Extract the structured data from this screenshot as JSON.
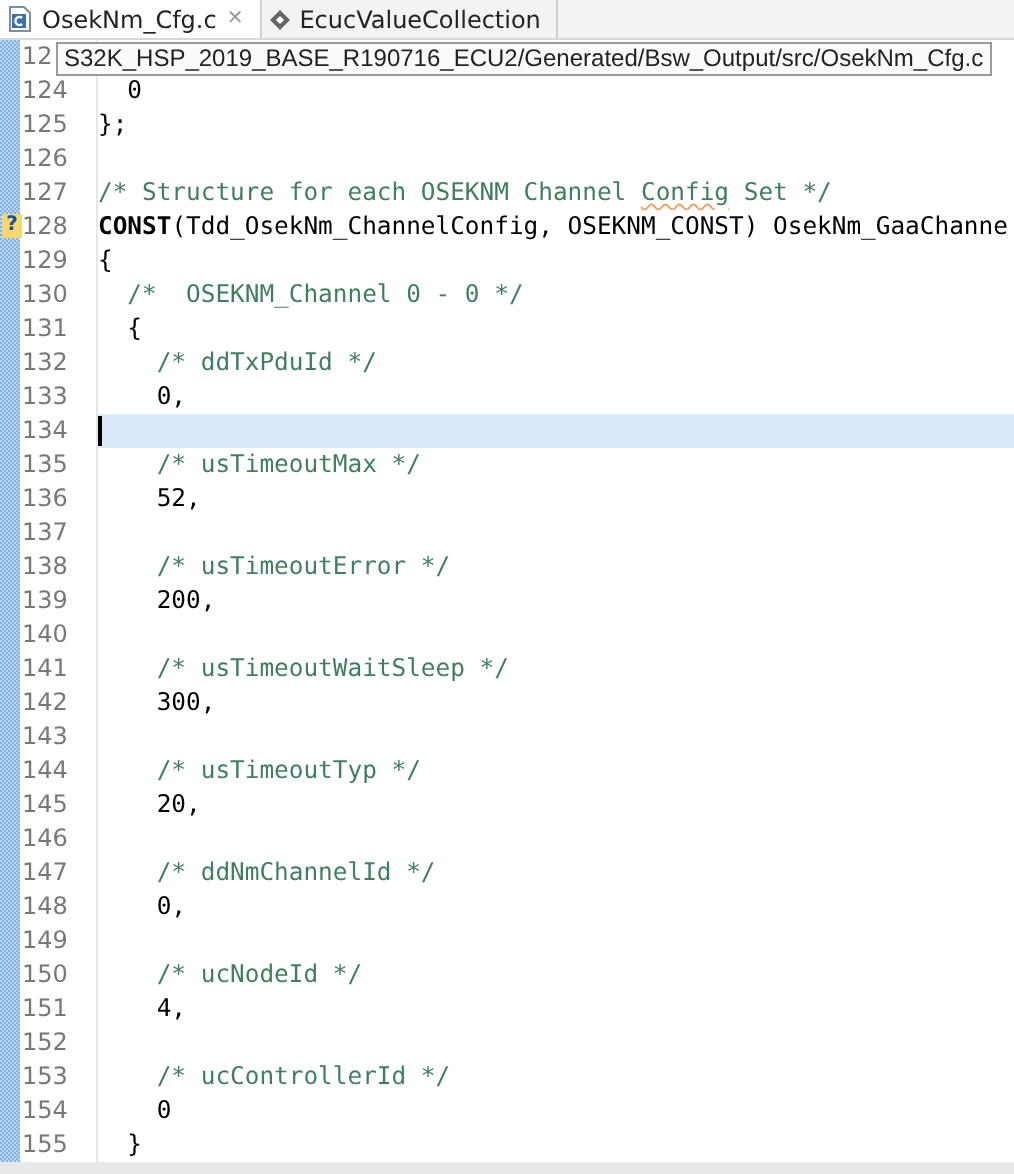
{
  "tabs": [
    {
      "kind": "source",
      "label": "OsekNm_Cfg.c",
      "close": "✕",
      "selected": true
    },
    {
      "kind": "model",
      "label": "EcucValueCollection",
      "selected": false
    }
  ],
  "tooltip": {
    "number": "12",
    "text": "S32K_HSP_2019_BASE_R190716_ECU2/Generated/Bsw_Output/src/OsekNm_Cfg.c"
  },
  "lines": [
    {
      "number": "124",
      "current": false,
      "segments": [
        {
          "kind": "code",
          "text": "  0"
        }
      ]
    },
    {
      "number": "125",
      "current": false,
      "segments": [
        {
          "kind": "code",
          "text": "};"
        }
      ]
    },
    {
      "number": "126",
      "current": false
    },
    {
      "number": "127",
      "current": false,
      "segments": [
        {
          "kind": "comment",
          "text": "/* Structure for each OSEKNM Channel "
        },
        {
          "kind": "comment",
          "text": "Config",
          "misspelled": true
        },
        {
          "kind": "comment",
          "text": " Set */"
        }
      ]
    },
    {
      "number": "128",
      "current": false,
      "marker": "?",
      "segments": [
        {
          "kind": "keyword",
          "text": "CONST"
        },
        {
          "kind": "code",
          "text": "(Tdd_OsekNm_ChannelConfig, OSEKNM_CONST) OsekNm_GaaChanne"
        }
      ]
    },
    {
      "number": "129",
      "current": false,
      "segments": [
        {
          "kind": "code",
          "text": "{"
        }
      ]
    },
    {
      "number": "130",
      "current": false,
      "segments": [
        {
          "kind": "comment",
          "text": "  /*  OSEKNM_Channel 0 - 0 */"
        }
      ]
    },
    {
      "number": "131",
      "current": false,
      "segments": [
        {
          "kind": "code",
          "text": "  {"
        }
      ]
    },
    {
      "number": "132",
      "current": false,
      "segments": [
        {
          "kind": "comment",
          "text": "    /* ddTxPduId */"
        }
      ]
    },
    {
      "number": "133",
      "current": false,
      "segments": [
        {
          "kind": "code",
          "text": "    0,"
        }
      ]
    },
    {
      "number": "134",
      "current": true
    },
    {
      "number": "135",
      "current": false,
      "segments": [
        {
          "kind": "comment",
          "text": "    /* usTimeoutMax */"
        }
      ]
    },
    {
      "number": "136",
      "current": false,
      "segments": [
        {
          "kind": "code",
          "text": "    52,"
        }
      ]
    },
    {
      "number": "137",
      "current": false
    },
    {
      "number": "138",
      "current": false,
      "segments": [
        {
          "kind": "comment",
          "text": "    /* usTimeoutError */"
        }
      ]
    },
    {
      "number": "139",
      "current": false,
      "segments": [
        {
          "kind": "code",
          "text": "    200,"
        }
      ]
    },
    {
      "number": "140",
      "current": false
    },
    {
      "number": "141",
      "current": false,
      "segments": [
        {
          "kind": "comment",
          "text": "    /* usTimeoutWaitSleep */"
        }
      ]
    },
    {
      "number": "142",
      "current": false,
      "segments": [
        {
          "kind": "code",
          "text": "    300,"
        }
      ]
    },
    {
      "number": "143",
      "current": false
    },
    {
      "number": "144",
      "current": false,
      "segments": [
        {
          "kind": "comment",
          "text": "    /* usTimeoutTyp */"
        }
      ]
    },
    {
      "number": "145",
      "current": false,
      "segments": [
        {
          "kind": "code",
          "text": "    20,"
        }
      ]
    },
    {
      "number": "146",
      "current": false
    },
    {
      "number": "147",
      "current": false,
      "segments": [
        {
          "kind": "comment",
          "text": "    /* ddNmChannelId */"
        }
      ]
    },
    {
      "number": "148",
      "current": false,
      "segments": [
        {
          "kind": "code",
          "text": "    0,"
        }
      ]
    },
    {
      "number": "149",
      "current": false
    },
    {
      "number": "150",
      "current": false,
      "segments": [
        {
          "kind": "comment",
          "text": "    /* ucNodeId */"
        }
      ]
    },
    {
      "number": "151",
      "current": false,
      "segments": [
        {
          "kind": "code",
          "text": "    4,"
        }
      ]
    },
    {
      "number": "152",
      "current": false
    },
    {
      "number": "153",
      "current": false,
      "segments": [
        {
          "kind": "comment",
          "text": "    /* ucControllerId */"
        }
      ]
    },
    {
      "number": "154",
      "current": false,
      "segments": [
        {
          "kind": "code",
          "text": "    0"
        }
      ]
    },
    {
      "number": "155",
      "current": false,
      "segments": [
        {
          "kind": "code",
          "text": "  }"
        }
      ]
    }
  ]
}
